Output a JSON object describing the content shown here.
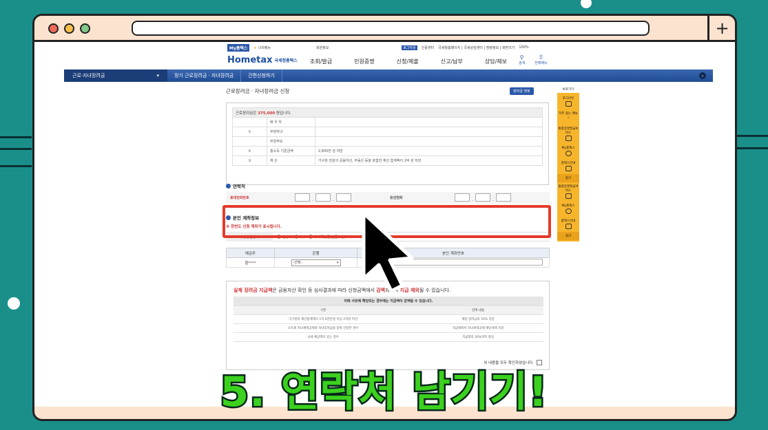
{
  "hometax": {
    "top_links": {
      "my_hometax": "My홈택스",
      "favorites": "나의메뉴",
      "user_info": "회원정보",
      "logout": "로그아웃",
      "certificate": "인증센터",
      "site_links": "국세청홈페이지 | 국세상담센터 | 범령정보 | 화면크기",
      "zoom": "100%"
    },
    "logo": {
      "main": "Hometax",
      "sub": "국세청홈택스"
    },
    "menu": [
      "조회/발급",
      "민원증명",
      "신청/제출",
      "신고/납부",
      "상담/제보"
    ],
    "icons": {
      "search": "검색",
      "all_menu": "전체메뉴"
    },
    "nav": {
      "current": "근로·자녀장려금",
      "crumb1": "정기 근로장려금 · 자녀장려금",
      "crumb2": "간편신청하기"
    },
    "page_title": "근로장려금 · 자녀장려금 신청",
    "help_button": "장려금 챗봇",
    "summary": {
      "amount_line_prefix": "근로장려금은 ",
      "amount": "375,000",
      "amount_line_suffix": " 원입니다.",
      "rows": [
        {
          "num": "",
          "label": "배 우 자",
          "value": ""
        },
        {
          "num": "①",
          "label": "부양자녀",
          "value": ""
        },
        {
          "num": "",
          "label": "부양부모",
          "value": ""
        },
        {
          "num": "②",
          "label": "총소득 기준금액",
          "value": "2,800만 원 미만"
        },
        {
          "num": "③",
          "label": "재      산",
          "value": "가구원 전원의 금융자산, 부동산 등을 포함한 재산 합계액이 2억 원 미만"
        }
      ]
    },
    "contact": {
      "title": "연락처",
      "mobile_label": "휴대전화번호",
      "phone_label": "유선전화"
    },
    "account": {
      "title": "본인 계좌정보",
      "warning": "※ 한번도 신청 계좌가 표시됩니다.",
      "receive_label": "수령방법선택",
      "option1": "신청자예금계좌",
      "option2": "우체국방문(현금수령)",
      "col_holder": "예금주",
      "col_bank": "은행",
      "col_account": "본인 계좌번호",
      "holder_value": "황****",
      "bank_select": "-선택-"
    },
    "notice": {
      "text_prefix": "실제 장려금 지급액",
      "text_mid": "은 금융자산 확인 등 심사결과에 따라 신청금액에서 ",
      "text_hl": "감액",
      "text_mid2": "되거나 ",
      "text_hl2": "지급 제외",
      "text_suffix": "될 수 있습니다.",
      "table_header": "아래 사유에 해당되는 경우에는 지급액이 감액될 수 있습니다.",
      "col1": "구분",
      "col2": "감액 내용",
      "rows": [
        {
          "reason": "가구원의 재산합계액이 1억 4천만원 이상 2억원 미만",
          "effect": "해당 장려금의 50% 차감"
        },
        {
          "reason": "소득세 자녀세액공제와 자녀장려금을 중복 신청한 경우",
          "effect": "지급액에서 자녀세액공제 해당세액 차감"
        },
        {
          "reason": "국세 체납액이 있는 경우",
          "effect": "지급액의 30%까지 충당"
        }
      ],
      "confirm": "위 내용을 모두 확인하였습니다."
    },
    "side": {
      "title": "바로가기",
      "items": [
        "로그아웃",
        "자주 찾는 메뉴",
        "통합증명발급서비스",
        "My홈택스",
        "홈택스안내",
        "접기"
      ],
      "items2": [
        "통합증명발급서비스",
        "My홈택스",
        "홈택스안내",
        "접기"
      ]
    }
  },
  "caption": "5. 연락처 남기기!"
}
